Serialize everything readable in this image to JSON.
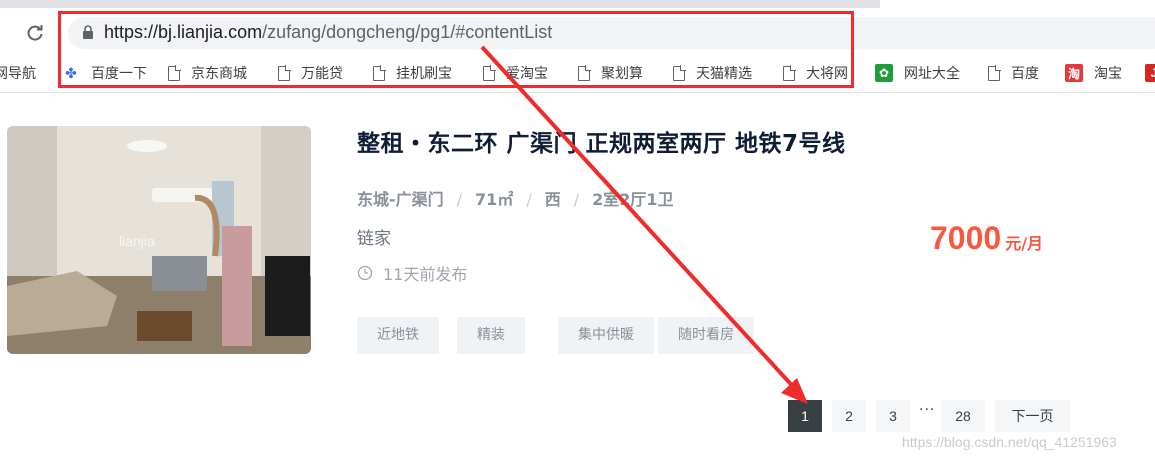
{
  "browser": {
    "url_host": "https://bj.lianjia.com",
    "url_path": "/zufang/dongcheng/pg1/#contentList",
    "bookmarks": [
      {
        "label": "网导航",
        "icon": "none"
      },
      {
        "label": "百度一下",
        "icon": "baidu-paw-icon"
      },
      {
        "label": "京东商城",
        "icon": "page-icon"
      },
      {
        "label": "万能贷",
        "icon": "page-icon"
      },
      {
        "label": "挂机刷宝",
        "icon": "page-icon"
      },
      {
        "label": "爱淘宝",
        "icon": "page-icon"
      },
      {
        "label": "聚划算",
        "icon": "page-icon"
      },
      {
        "label": "天猫精选",
        "icon": "page-icon"
      },
      {
        "label": "大将网",
        "icon": "page-icon"
      },
      {
        "label": "网址大全",
        "icon": "green-square-icon"
      },
      {
        "label": "百度",
        "icon": "page-icon"
      },
      {
        "label": "淘宝",
        "icon": "taobao-icon"
      }
    ]
  },
  "listing": {
    "title": "整租・东二环 广渠门 正规两室两厅 地铁7号线",
    "district": "东城-广渠门",
    "area": "71㎡",
    "orientation": "西",
    "layout": "2室2厅1卫",
    "brand": "链家",
    "published": "11天前发布",
    "price": "7000",
    "price_unit": "元/月",
    "tags": [
      "近地铁",
      "精装",
      "集中供暖",
      "随时看房"
    ],
    "image_watermark": "lianjia"
  },
  "pagination": {
    "pages": [
      "1",
      "2",
      "3",
      "28"
    ],
    "ellipsis": "···",
    "next": "下一页",
    "active": "1"
  },
  "watermark": "https://blog.csdn.net/qq_41251963",
  "colors": {
    "highlight": "#ef2b2b",
    "price": "#fa5741",
    "active_page": "#394043"
  }
}
